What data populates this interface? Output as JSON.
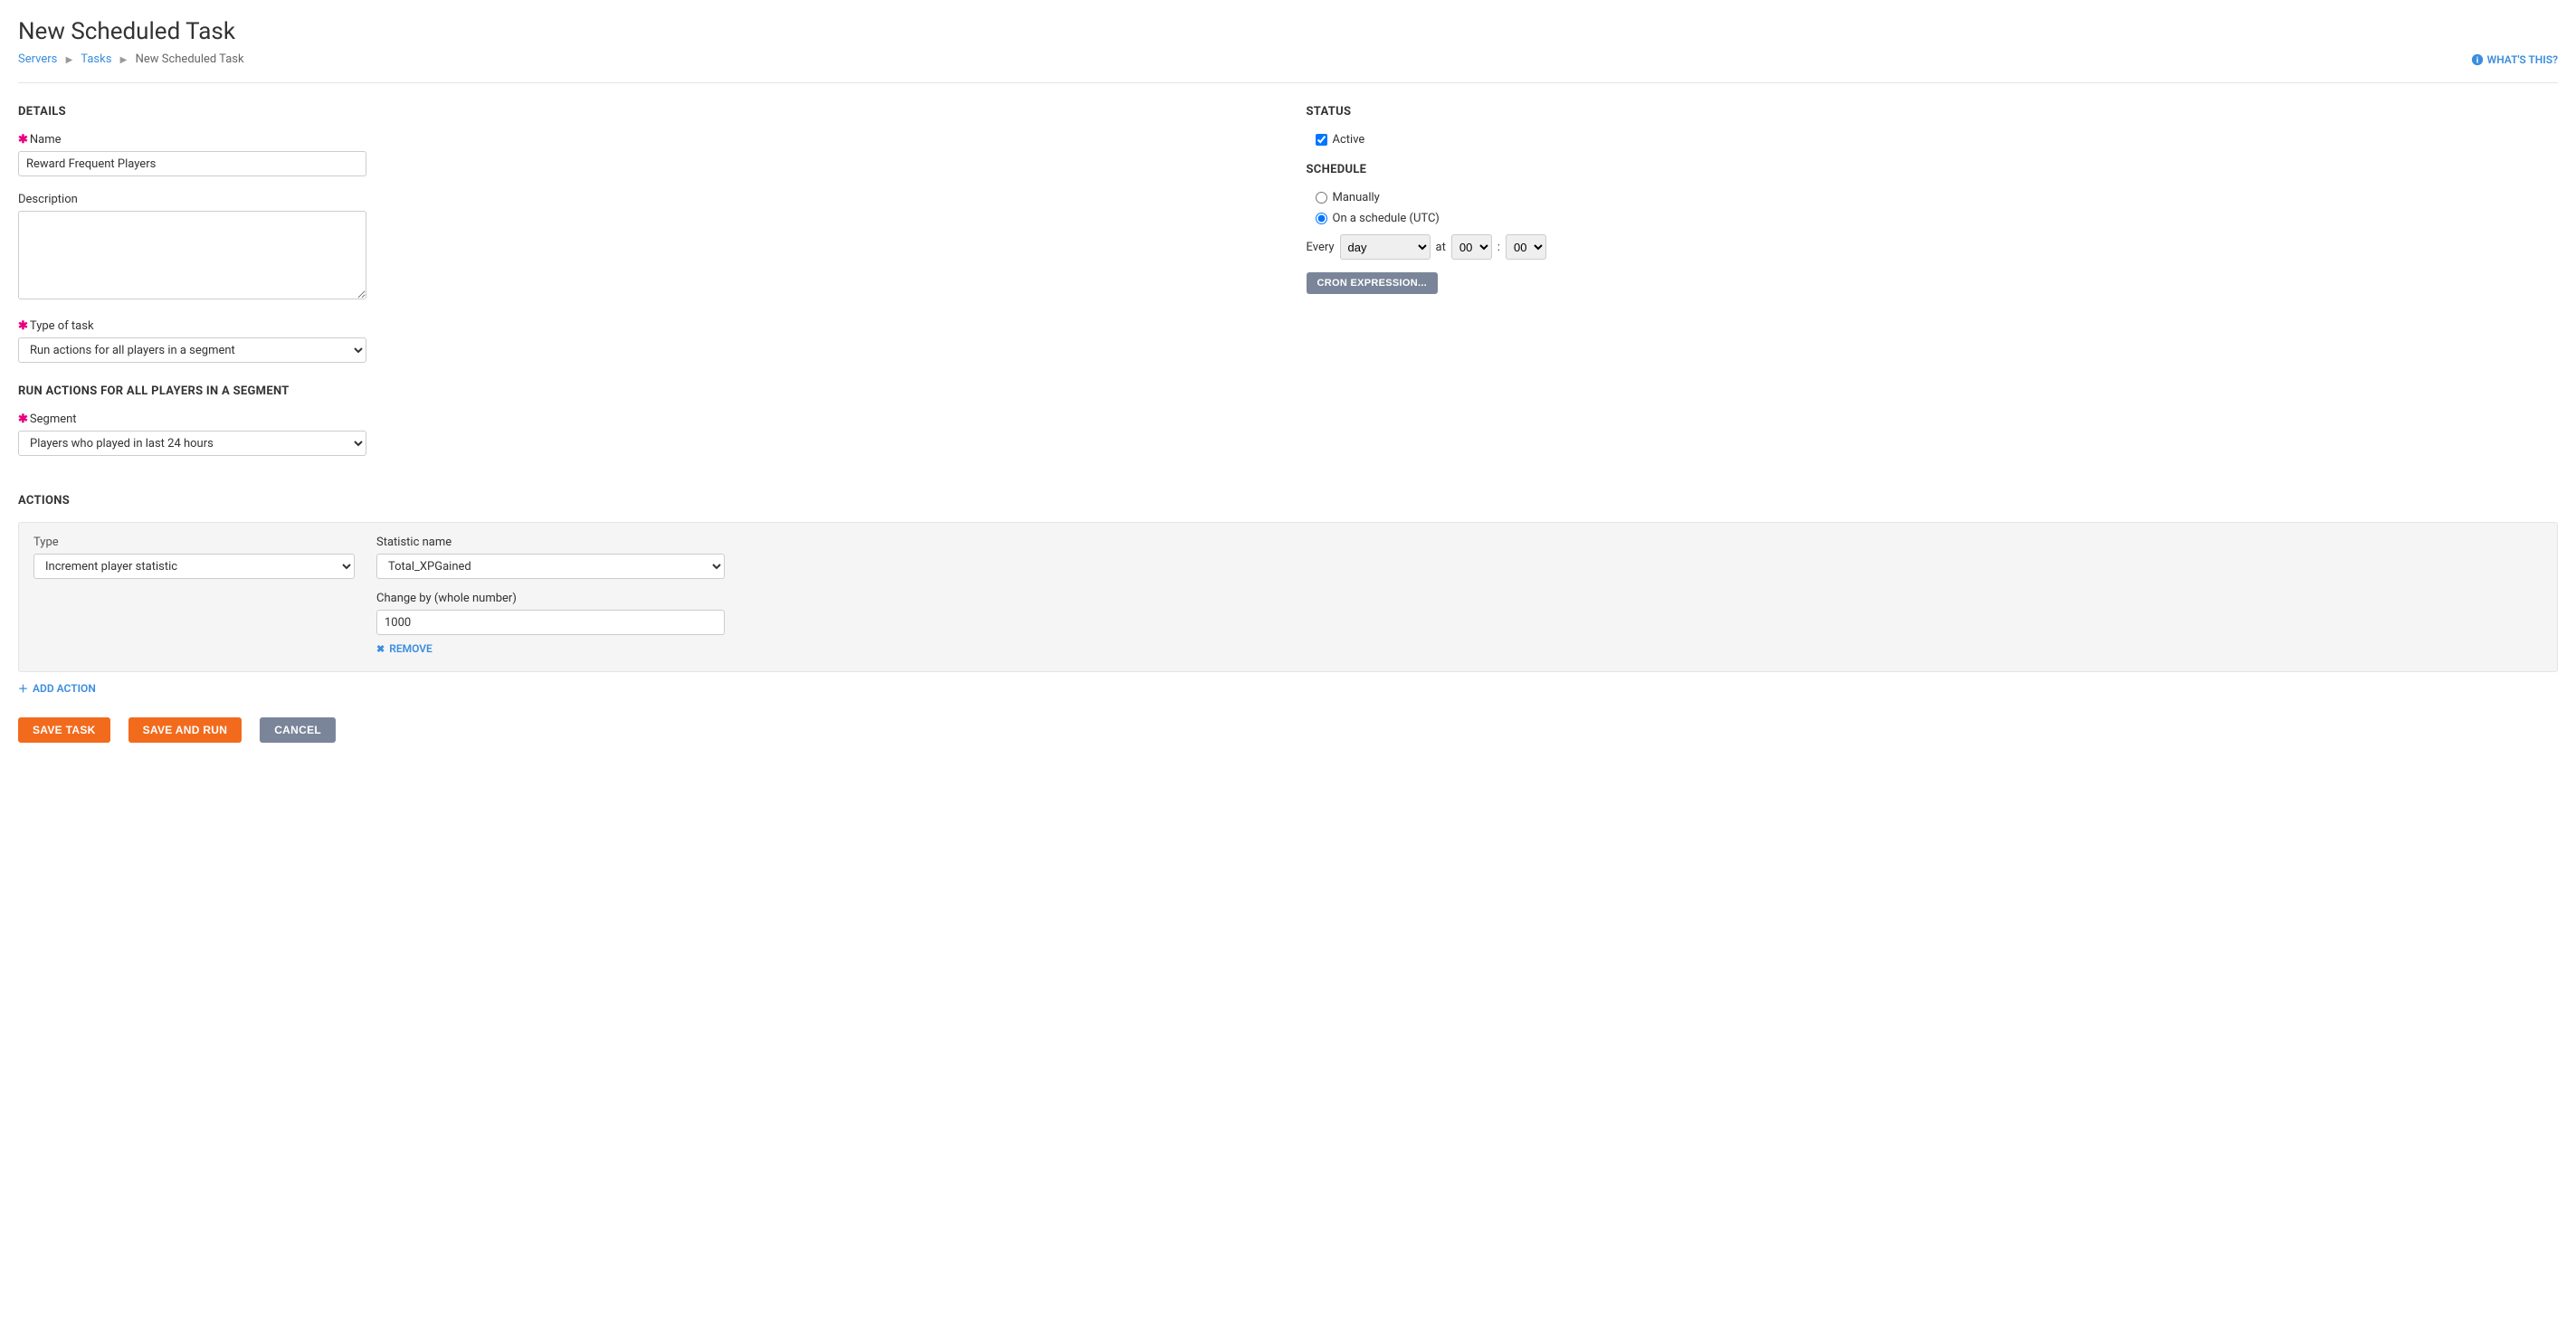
{
  "page": {
    "title": "New Scheduled Task",
    "whats_this": "WHAT'S THIS?"
  },
  "breadcrumb": {
    "servers": "Servers",
    "tasks": "Tasks",
    "current": "New Scheduled Task"
  },
  "details": {
    "heading": "DETAILS",
    "name_label": "Name",
    "name_value": "Reward Frequent Players",
    "description_label": "Description",
    "description_value": "",
    "type_label": "Type of task",
    "type_value": "Run actions for all players in a segment",
    "segment_heading": "RUN ACTIONS FOR ALL PLAYERS IN A SEGMENT",
    "segment_label": "Segment",
    "segment_value": "Players who played in last 24 hours"
  },
  "status": {
    "heading": "STATUS",
    "active_label": "Active",
    "active_checked": true
  },
  "schedule": {
    "heading": "SCHEDULE",
    "manually_label": "Manually",
    "on_schedule_label": "On a schedule (UTC)",
    "selected": "on_schedule",
    "every_label": "Every",
    "every_unit": "day",
    "at_label": "at",
    "hour": "00",
    "minute": "00",
    "cron_button": "CRON EXPRESSION..."
  },
  "actions": {
    "heading": "ACTIONS",
    "type_label": "Type",
    "type_value": "Increment player statistic",
    "stat_label": "Statistic name",
    "stat_value": "Total_XPGained",
    "change_label": "Change by (whole number)",
    "change_value": "1000",
    "remove_label": "REMOVE",
    "add_label": "ADD ACTION"
  },
  "buttons": {
    "save": "SAVE TASK",
    "save_run": "SAVE AND RUN",
    "cancel": "CANCEL"
  }
}
